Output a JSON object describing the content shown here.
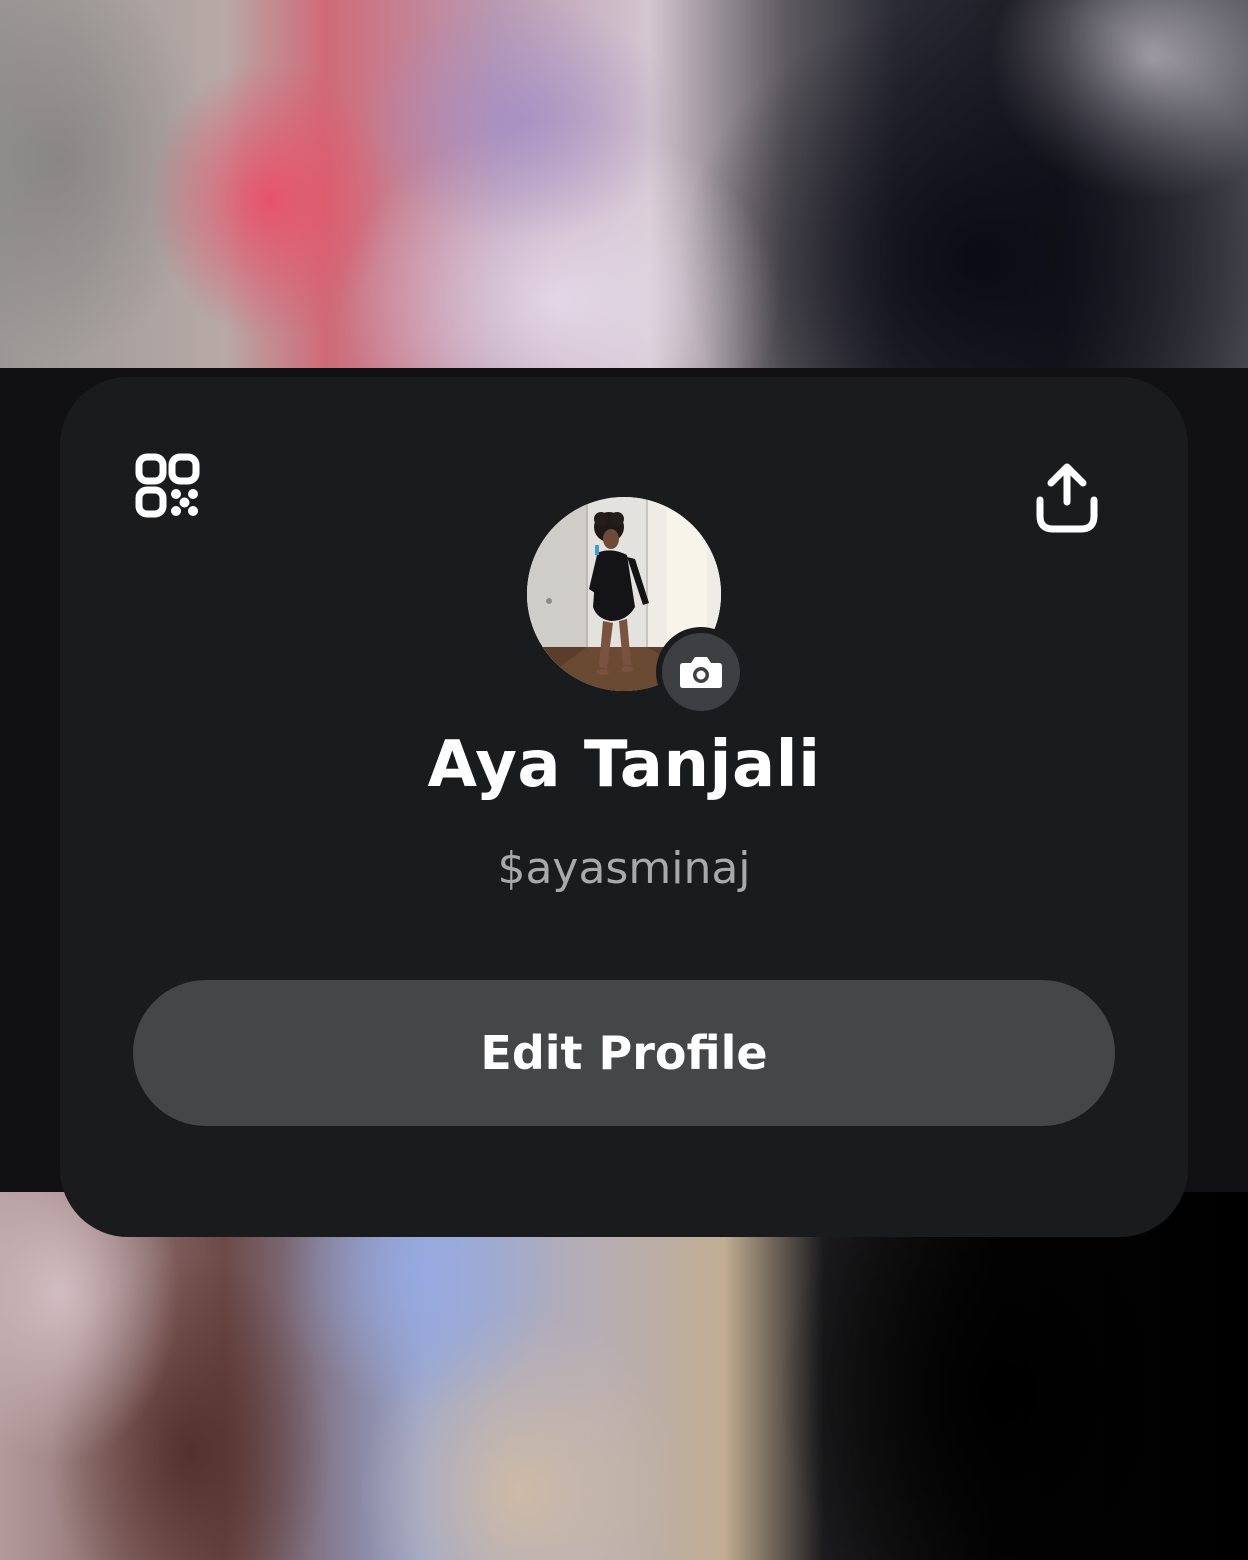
{
  "profile": {
    "display_name": "Aya Tanjali",
    "cashtag": "$ayasminaj",
    "edit_label": "Edit Profile"
  },
  "icons": {
    "qr": "qr-code-icon",
    "share": "share-icon",
    "camera": "camera-icon"
  },
  "colors": {
    "card_bg": "#1a1b1d",
    "button_bg": "#454648",
    "handle_text": "#a8a9ab",
    "name_text": "#ffffff"
  }
}
